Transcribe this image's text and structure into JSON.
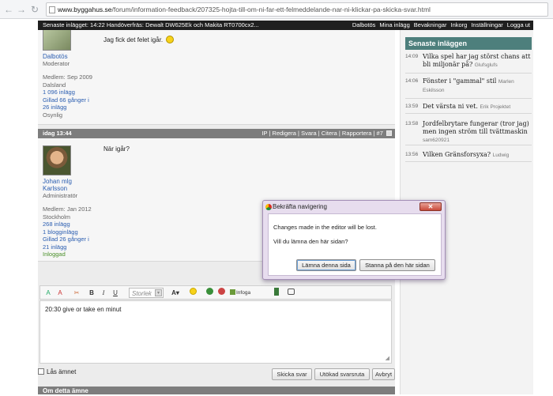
{
  "browser": {
    "url_host": "www.byggahus.se",
    "url_path": "/forum/information-feedback/207325-hojta-till-om-ni-far-ett-felmeddelande-nar-ni-klickar-pa-skicka-svar.html"
  },
  "topbar": {
    "latest": "Senaste inlägget: 14:22 Handöverfräs: Dewalt DW625Ek och Makita RT0700cx2...",
    "links": [
      "Dalbotös",
      "Mina inlägg",
      "Bevakningar",
      "Inkorg",
      "Inställningar",
      "Logga ut"
    ]
  },
  "post1": {
    "username": "Dalbotös",
    "role": "Moderator",
    "member_since": "Medlem: Sep 2009",
    "location": "Dalsland",
    "posts": "1 096 inlägg",
    "liked": "Gillad 66 gånger i",
    "liked2": "26 inlägg",
    "status": "Osynlig",
    "text": "Jag fick det felet igår."
  },
  "post2": {
    "time": "idag 13:44",
    "actions": "IP | Redigera | Svara | Citera | Rapportera | #7",
    "username": "Johan mlg",
    "username2": "Karlsson",
    "role": "Administratör",
    "member_since": "Medlem: Jan 2012",
    "location": "Stockholm",
    "posts": "268 inlägg",
    "blog": "1 blogginlägg",
    "liked": "Gillad 26 gånger i",
    "liked2": "21 inlägg",
    "status": "Inloggad",
    "text": "När igår?"
  },
  "editor": {
    "font_size_label": "Storlek",
    "insert_image_label": "Infoga bild",
    "text": "20:30 give or take en minut"
  },
  "form": {
    "lock_label": "Lås ämnet",
    "send_button": "Skicka svar",
    "extended_button": "Utökad svarsruta",
    "cancel_button": "Avbryt"
  },
  "footer_title": "Om detta ämne",
  "sidebar": {
    "title": "Senaste inläggen",
    "items": [
      {
        "time": "14:09",
        "title": "Vilka spel har jag störst chans att bli miljonär på?",
        "author": "Glufsglufs"
      },
      {
        "time": "14:06",
        "title": "Fönster i \"gammal\" stil",
        "author": "Marlen Eskilsson"
      },
      {
        "time": "13:59",
        "title": "Det värsta ni vet.",
        "author": "Erik Projektet"
      },
      {
        "time": "13:58",
        "title": "Jordfelbrytare fungerar (tror jag) men ingen ström till tvättmaskin",
        "author": "sam620921"
      },
      {
        "time": "13:56",
        "title": "Vilken Gränsforsyxa?",
        "author": "Ludwig"
      }
    ]
  },
  "dialog": {
    "title": "Bekräfta navigering",
    "message1": "Changes made in the editor will be lost.",
    "message2": "Vill du lämna den här sidan?",
    "leave_button": "Lämna denna sida",
    "stay_button": "Stanna på den här sidan"
  }
}
